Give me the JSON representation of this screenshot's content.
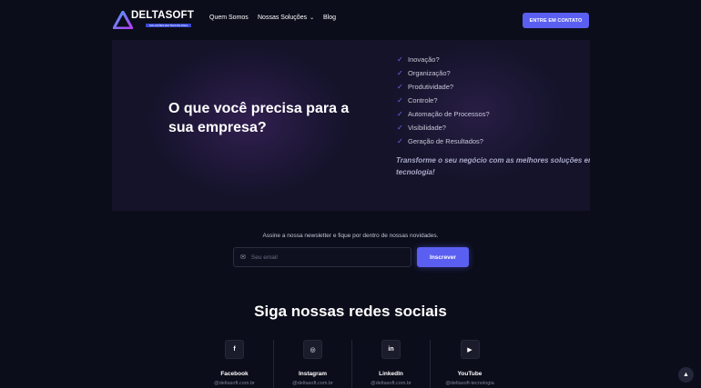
{
  "header": {
    "logo_text": "DELTASOFT",
    "logo_subtext": "SOLUÇÕES EM TECNOLOGIA",
    "nav": [
      {
        "label": "Quem Somos"
      },
      {
        "label": "Nossas Soluções"
      },
      {
        "label": "Blog"
      }
    ],
    "cta_label": "ENTRE EM CONTATO"
  },
  "hero": {
    "title": "O que você precisa para a sua empresa?",
    "checklist": [
      "Inovação?",
      "Organização?",
      "Produtividade?",
      "Controle?",
      "Automação de Processos?",
      "Visibilidade?",
      "Geração de Resultados?"
    ],
    "tagline": "Transforme o seu negócio com as melhores soluções em tecnologia!"
  },
  "newsletter": {
    "text": "Assine a nossa newsletter e fique por dentro de nossas novidades.",
    "placeholder": "Seu email",
    "button_label": "Inscrever"
  },
  "social": {
    "title": "Siga nossas redes sociais",
    "items": [
      {
        "name": "Facebook",
        "handle": "@deltasoft.com.br",
        "icon": "f"
      },
      {
        "name": "Instagram",
        "handle": "@deltasoft.com.br",
        "icon": "◎"
      },
      {
        "name": "LinkedIn",
        "handle": "@deltasoft.com.br",
        "icon": "in"
      },
      {
        "name": "YouTube",
        "handle": "@deltasoft-tecnologia",
        "icon": "▶"
      }
    ]
  },
  "colors": {
    "background": "#0b0d1a",
    "accent": "#5b5ff1"
  }
}
